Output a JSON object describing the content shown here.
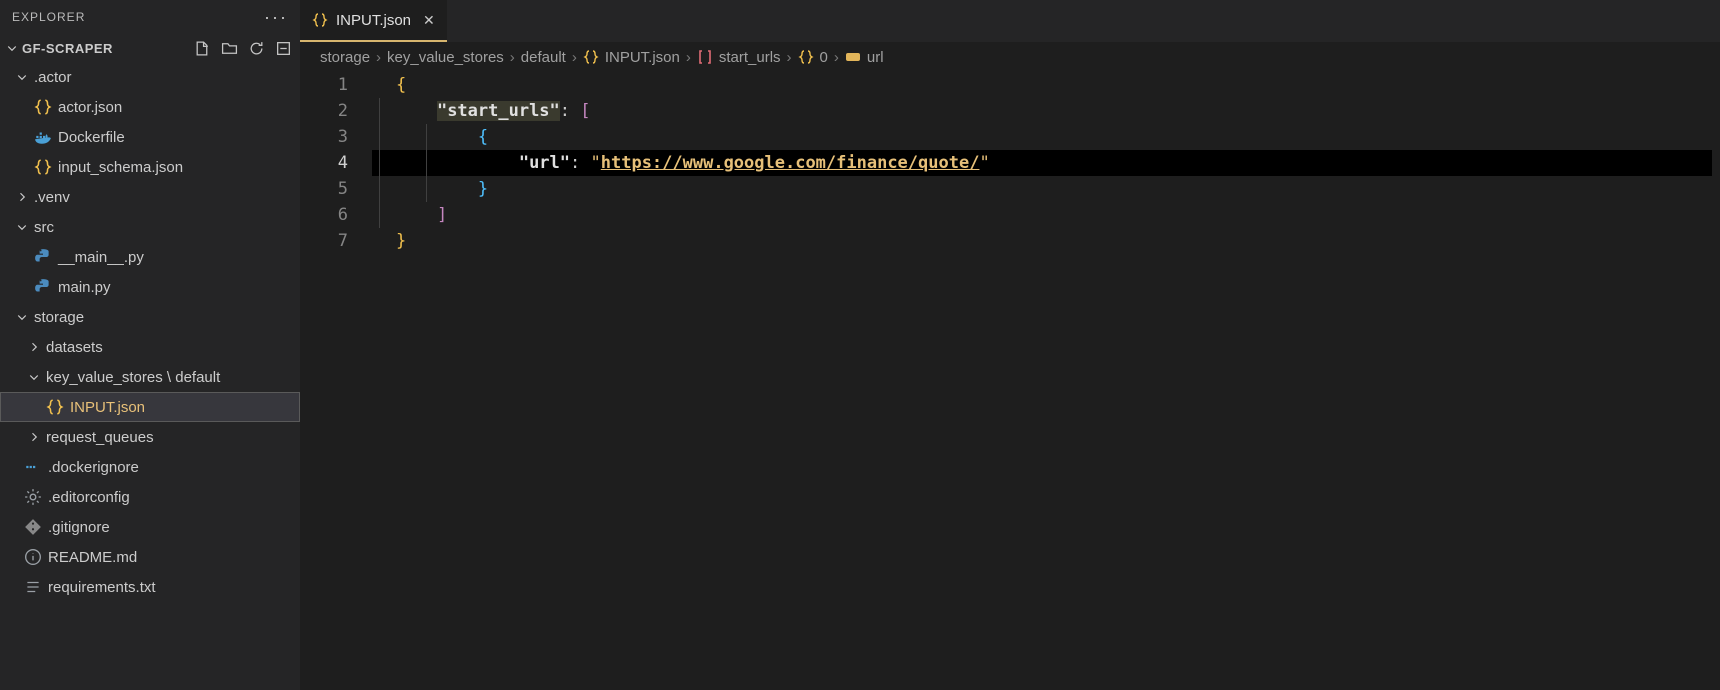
{
  "explorer": {
    "title": "EXPLORER",
    "project": "GF-SCRAPER",
    "tree": {
      "actor": {
        "label": ".actor"
      },
      "actor_json": {
        "label": "actor.json"
      },
      "dockerfile": {
        "label": "Dockerfile"
      },
      "input_schema": {
        "label": "input_schema.json"
      },
      "venv": {
        "label": ".venv"
      },
      "src": {
        "label": "src"
      },
      "main_py": {
        "label": "__main__.py"
      },
      "mainpy": {
        "label": "main.py"
      },
      "storage": {
        "label": "storage"
      },
      "datasets": {
        "label": "datasets"
      },
      "kvs": {
        "label": "key_value_stores \\ default"
      },
      "input_json": {
        "label": "INPUT.json"
      },
      "request_queues": {
        "label": "request_queues"
      },
      "dockerignore": {
        "label": ".dockerignore"
      },
      "editorconfig": {
        "label": ".editorconfig"
      },
      "gitignore": {
        "label": ".gitignore"
      },
      "readme": {
        "label": "README.md"
      },
      "requirements": {
        "label": "requirements.txt"
      }
    }
  },
  "tab": {
    "label": "INPUT.json"
  },
  "breadcrumbs": {
    "c1": "storage",
    "c2": "key_value_stores",
    "c3": "default",
    "c4": "INPUT.json",
    "c5": "start_urls",
    "c6": "0",
    "c7": "url"
  },
  "editor": {
    "lines": [
      "1",
      "2",
      "3",
      "4",
      "5",
      "6",
      "7"
    ],
    "content": {
      "key_start_urls": "\"start_urls\"",
      "key_url": "\"url\"",
      "url_value": "https://www.google.com/finance/quote/"
    }
  }
}
